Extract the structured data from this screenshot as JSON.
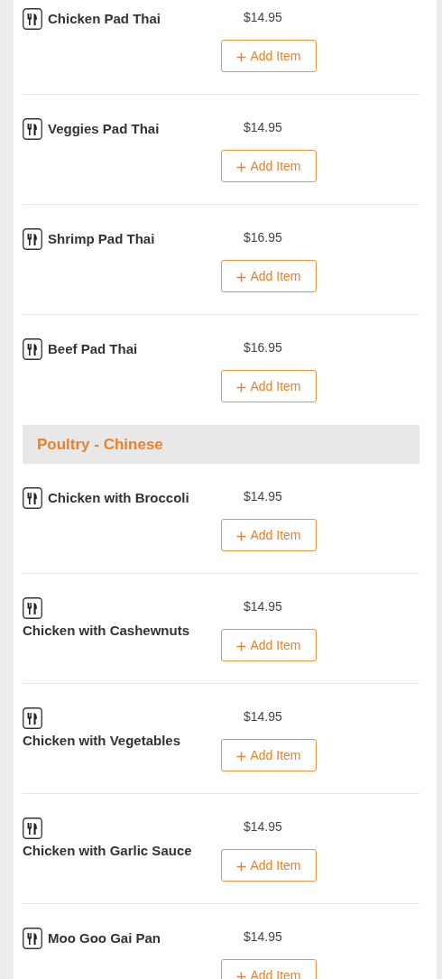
{
  "sections": [
    {
      "items": [
        {
          "name": "Chicken Pad Thai",
          "price": "$14.95",
          "button": "Add Item"
        },
        {
          "name": "Veggies Pad Thai",
          "price": "$14.95",
          "button": "Add Item"
        },
        {
          "name": "Shrimp Pad Thai",
          "price": "$16.95",
          "button": "Add Item"
        },
        {
          "name": "Beef Pad Thai",
          "price": "$16.95",
          "button": "Add Item"
        }
      ]
    },
    {
      "title": "Poultry - Chinese",
      "items": [
        {
          "name": "Chicken with Broccoli",
          "price": "$14.95",
          "button": "Add Item"
        },
        {
          "name": "Chicken with Cashewnuts",
          "price": "$14.95",
          "button": "Add Item"
        },
        {
          "name": "Chicken with Vegetables",
          "price": "$14.95",
          "button": "Add Item"
        },
        {
          "name": "Chicken with Garlic Sauce",
          "price": "$14.95",
          "button": "Add Item"
        },
        {
          "name": "Moo Goo Gai Pan",
          "price": "$14.95",
          "button": "Add Item"
        }
      ]
    }
  ]
}
